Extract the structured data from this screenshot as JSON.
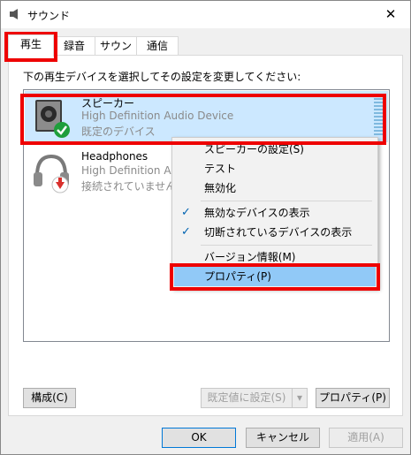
{
  "window": {
    "title": "サウンド",
    "close_glyph": "✕"
  },
  "tabs": [
    {
      "label": "再生",
      "active": true
    },
    {
      "label": "録音",
      "active": false
    },
    {
      "label": "サウンド",
      "active": false
    },
    {
      "label": "通信",
      "active": false
    }
  ],
  "panel": {
    "instruction": "下の再生デバイスを選択してその設定を変更してください:"
  },
  "devices": [
    {
      "name": "スピーカー",
      "description": "High Definition Audio Device",
      "status": "既定のデバイス",
      "selected": true,
      "icon": "speaker-icon",
      "badge": "default-check-badge"
    },
    {
      "name": "Headphones",
      "description": "High Definition Audio Device",
      "status": "接続されていません",
      "selected": false,
      "icon": "headphones-icon",
      "badge": "unplugged-badge"
    }
  ],
  "context_menu": {
    "items": [
      {
        "label": "スピーカーの設定(S)",
        "checked": false
      },
      {
        "label": "テスト",
        "checked": false
      },
      {
        "label": "無効化",
        "checked": false
      },
      {
        "label": "無効なデバイスの表示",
        "checked": true
      },
      {
        "label": "切断されているデバイスの表示",
        "checked": true
      },
      {
        "label": "バージョン情報(M)",
        "checked": false
      },
      {
        "label": "プロパティ(P)",
        "checked": false,
        "highlighted": true
      }
    ],
    "check_glyph": "✓"
  },
  "buttons": {
    "configure": "構成(C)",
    "set_default": "既定値に設定(S)",
    "set_default_arrow": "▾",
    "properties": "プロパティ(P)",
    "ok": "OK",
    "cancel": "キャンセル",
    "apply": "適用(A)"
  },
  "colors": {
    "selection": "#cce8ff",
    "menu_highlight": "#91c9f7",
    "annotation_red": "#ee0000",
    "check_green": "#1e9e3b",
    "unplug_red": "#d9302c"
  }
}
